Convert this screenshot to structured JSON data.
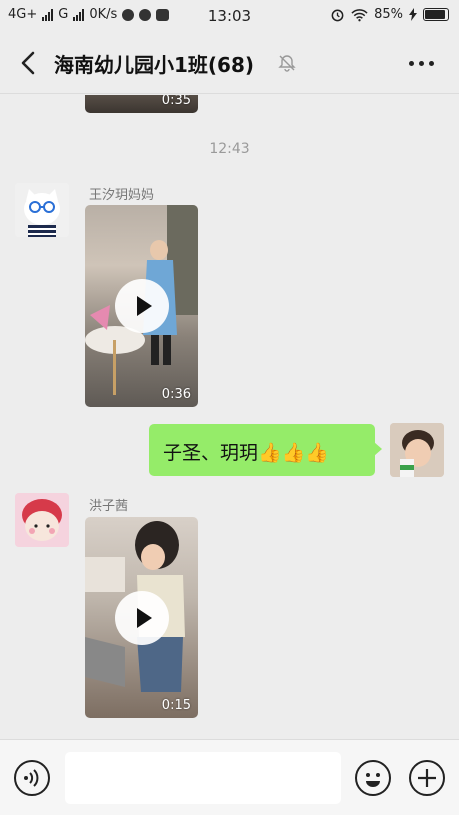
{
  "status_bar": {
    "network": "4G+",
    "network2": "G",
    "speed": "0K/s",
    "time": "13:03",
    "battery": "85%"
  },
  "header": {
    "title": "海南幼儿园小1班(68)",
    "back_icon": "chevron-left-icon",
    "mute_icon": "bell-off-icon",
    "more_icon": "more-dots-icon"
  },
  "messages": {
    "top_video": {
      "duration": "0:35"
    },
    "time_separator": "12:43",
    "msg1": {
      "sender": "王汐玥妈妈",
      "duration": "0:36"
    },
    "msg2": {
      "text": "子圣、玥玥👍👍👍"
    },
    "msg3": {
      "sender": "洪子茜",
      "duration": "0:15"
    }
  },
  "bottom_bar": {
    "voice_icon": "voice-icon",
    "input_value": "",
    "emoji_icon": "emoji-icon",
    "plus_icon": "plus-icon"
  },
  "colors": {
    "background": "#ededed",
    "bubble_green": "#95ec69"
  }
}
